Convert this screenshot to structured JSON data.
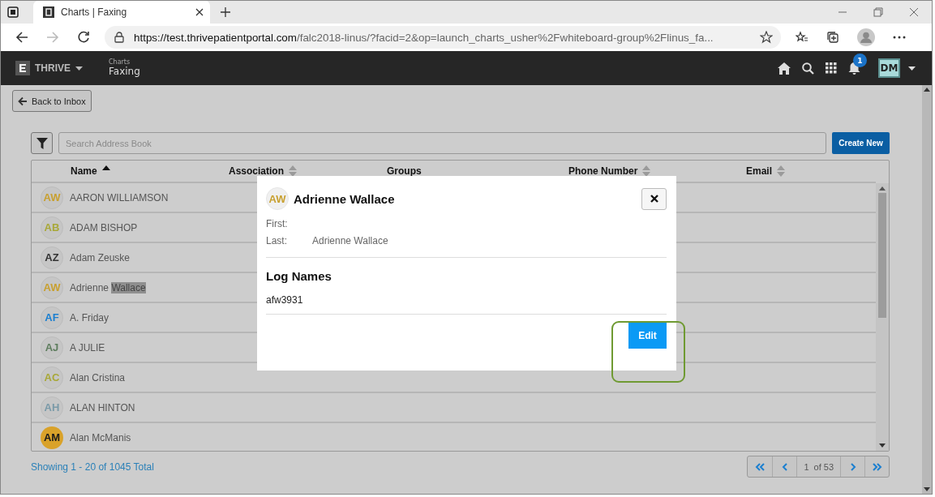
{
  "browser": {
    "tab_title": "Charts | Faxing",
    "url_host": "https://test.thrivepatientportal.com",
    "url_path": "/falc2018-linus/?facid=2&op=launch_charts_usher%2Fwhiteboard-group%2Flinus_fa..."
  },
  "app": {
    "brand": "THRIVE",
    "section": "Charts",
    "page": "Faxing",
    "notification_count": "1",
    "user_initials": "DM"
  },
  "back_button": "Back to Inbox",
  "search": {
    "placeholder": "Search Address Book"
  },
  "create_button": "Create New",
  "table": {
    "columns": [
      {
        "label": "Name",
        "sortable": true,
        "sorted": true
      },
      {
        "label": "Association",
        "sortable": true,
        "sorted": false
      },
      {
        "label": "Groups",
        "sortable": false
      },
      {
        "label": "Phone Number",
        "sortable": true,
        "sorted": false
      },
      {
        "label": "Email",
        "sortable": true,
        "sorted": false
      }
    ],
    "rows": [
      {
        "initials": "AW",
        "color": "#c8a030",
        "kind": "outline",
        "name": "AARON WILLIAMSON"
      },
      {
        "initials": "AB",
        "color": "#a8a838",
        "kind": "outline",
        "name": "ADAM BISHOP"
      },
      {
        "initials": "AZ",
        "color": "#333333",
        "kind": "outline",
        "name": "Adam Zeuske"
      },
      {
        "initials": "AW",
        "color": "#c8a030",
        "kind": "outline",
        "name": "Adrienne",
        "selected_text": "Wallace"
      },
      {
        "initials": "AF",
        "color": "#1b7fd0",
        "kind": "outline",
        "name": "A. Friday"
      },
      {
        "initials": "AJ",
        "color": "#5e7d5e",
        "kind": "outline",
        "name": "A JULIE"
      },
      {
        "initials": "AC",
        "color": "#a8a838",
        "kind": "outline",
        "name": "Alan Cristina"
      },
      {
        "initials": "AH",
        "color": "#7a9aa8",
        "kind": "outline",
        "name": "ALAN HINTON"
      },
      {
        "initials": "AM",
        "color": "#d9a22a",
        "kind": "filled",
        "name": "Alan McManis"
      }
    ]
  },
  "summary": "Showing 1 - 20 of 1045 Total",
  "pagination": {
    "current": "1",
    "of": "of 53"
  },
  "modal": {
    "initials": "AW",
    "color": "#c8a030",
    "name": "Adrienne Wallace",
    "fields": [
      {
        "label": "First:"
      },
      {
        "label": "Last:",
        "value": "Adrienne Wallace"
      }
    ],
    "section_title": "Log Names",
    "log_names": [
      "afw3931"
    ],
    "edit_button": "Edit",
    "edit_highlighted": true
  }
}
